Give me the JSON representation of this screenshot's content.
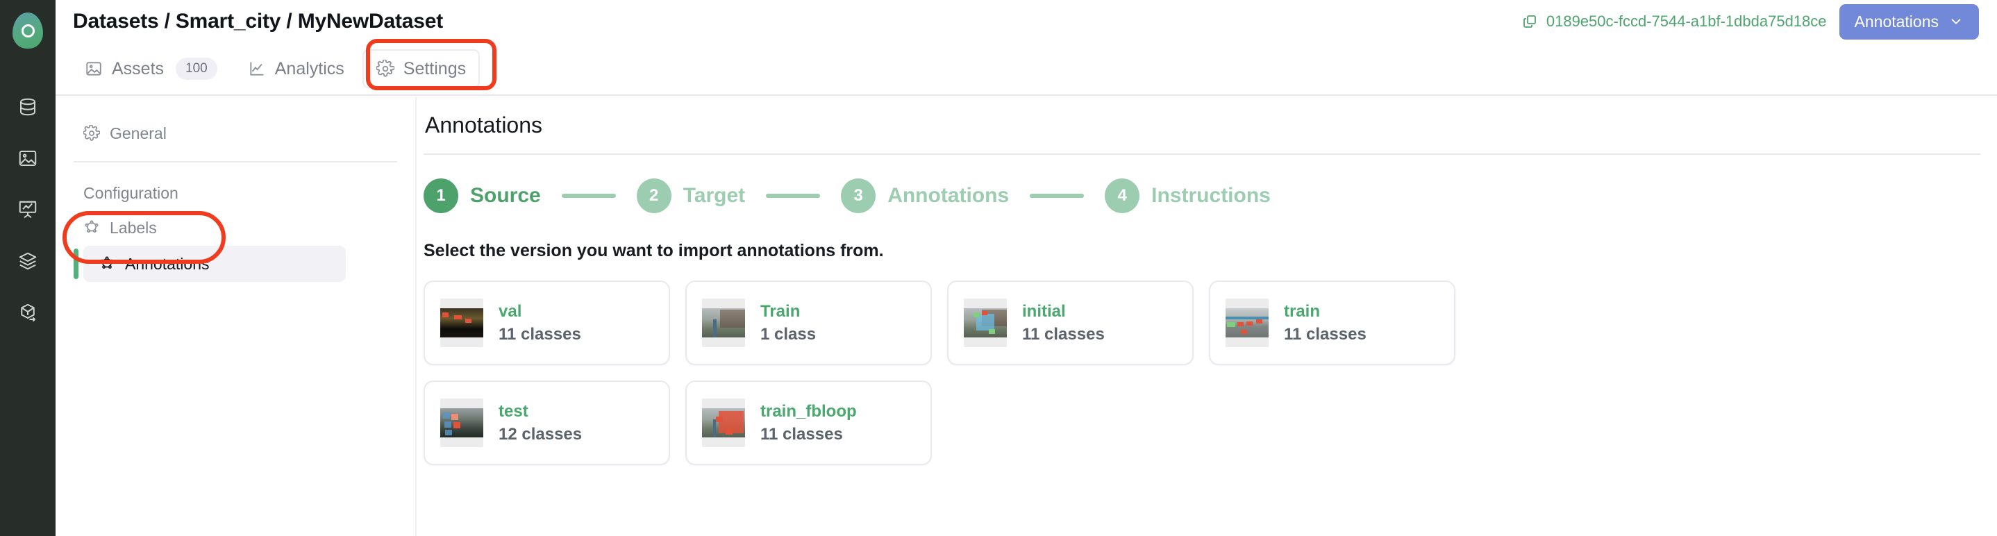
{
  "rail": {
    "logo_icon": "app-logo",
    "items": [
      {
        "icon": "database-icon",
        "name": "datasets"
      },
      {
        "icon": "image-icon",
        "name": "assets"
      },
      {
        "icon": "analytics-icon",
        "name": "analytics"
      },
      {
        "icon": "layers-icon",
        "name": "models"
      },
      {
        "icon": "export-box-icon",
        "name": "deploy"
      }
    ]
  },
  "header": {
    "breadcrumb": "Datasets / Smart_city / MyNewDataset",
    "uuid": "0189e50c-fccd-7544-a1bf-1dbda75d18ce",
    "copy_icon": "copy-icon",
    "action_button": {
      "label": "Annotations",
      "chevron_icon": "chevron-down-icon",
      "color": "#7289da"
    }
  },
  "tabs": [
    {
      "label": "Assets",
      "icon": "image-icon",
      "badge": "100",
      "selected": false
    },
    {
      "label": "Analytics",
      "icon": "analytics-icon",
      "badge": "",
      "selected": false
    },
    {
      "label": "Settings",
      "icon": "gear-icon",
      "badge": "",
      "selected": true
    }
  ],
  "settings_nav": {
    "general": {
      "label": "General",
      "icon": "gear-icon"
    },
    "section_title": "Configuration",
    "items": [
      {
        "label": "Labels",
        "icon": "polygon-icon",
        "active": false
      },
      {
        "label": "Annotations",
        "icon": "polygon-icon",
        "active": true
      }
    ]
  },
  "main": {
    "title": "Annotations",
    "steps": [
      {
        "num": "1",
        "label": "Source",
        "active": true
      },
      {
        "num": "2",
        "label": "Target",
        "active": false
      },
      {
        "num": "3",
        "label": "Annotations",
        "active": false
      },
      {
        "num": "4",
        "label": "Instructions",
        "active": false
      }
    ],
    "prompt": "Select the version you want to import annotations from.",
    "versions": [
      {
        "name": "val",
        "classes": "11 classes"
      },
      {
        "name": "Train",
        "classes": "1 class"
      },
      {
        "name": "initial",
        "classes": "11 classes"
      },
      {
        "name": "train",
        "classes": "11 classes"
      },
      {
        "name": "test",
        "classes": "12 classes"
      },
      {
        "name": "train_fbloop",
        "classes": "11 classes"
      }
    ]
  },
  "colors": {
    "accent_green": "#4da26c",
    "step_inactive": "#9dcdb0",
    "button_blue": "#7289da",
    "rail_dark": "#272e2a",
    "highlight_ring": "#f03c1e"
  }
}
